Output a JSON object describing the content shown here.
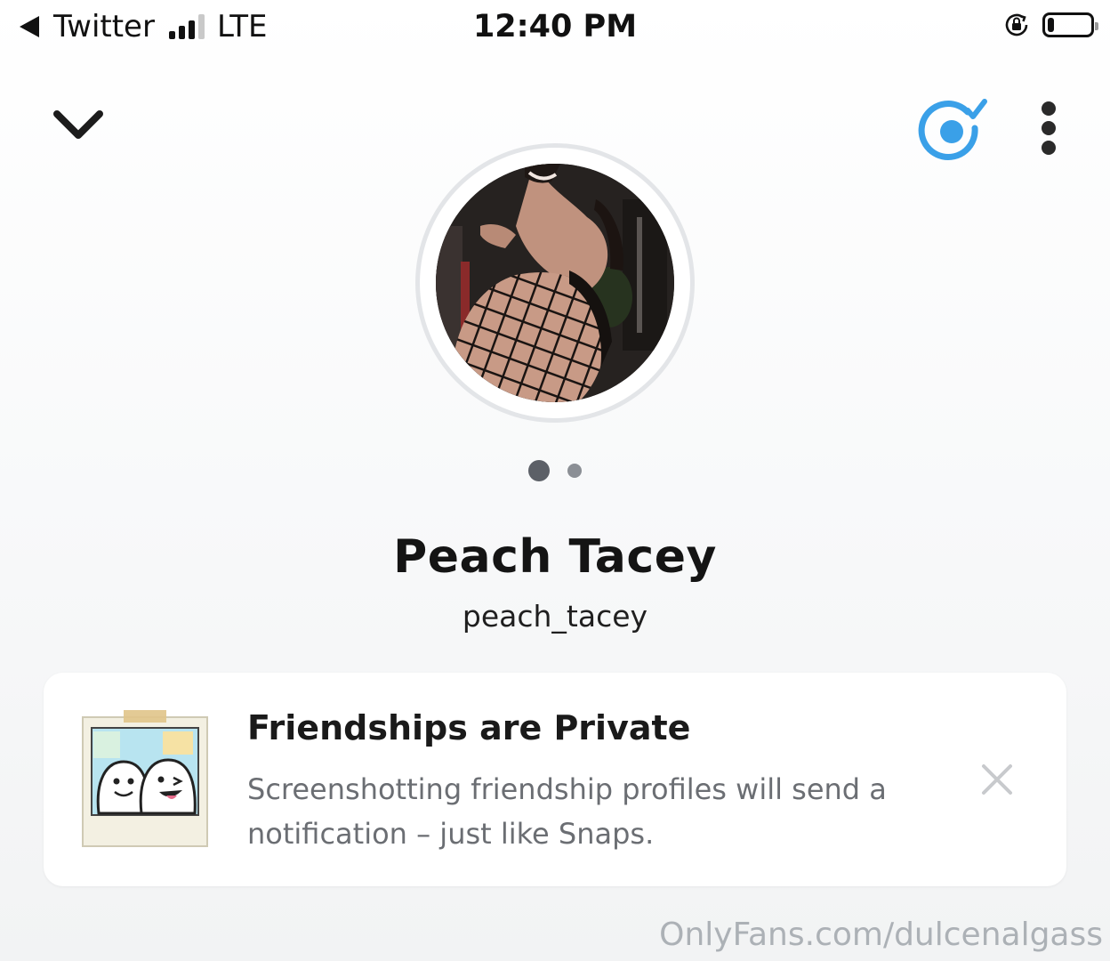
{
  "status_bar": {
    "back_app": "Twitter",
    "network": "LTE",
    "time": "12:40 PM",
    "battery_level": 0.15
  },
  "nav": {
    "collapse_icon": "chevron-down-icon",
    "story_icon": "story-ring-icon",
    "more_icon": "vertical-ellipsis-icon",
    "accent_color": "#3aa0e8"
  },
  "profile": {
    "display_name": "Peach Tacey",
    "username": "peach_tacey",
    "pager": {
      "count": 2,
      "active_index": 0
    }
  },
  "notice_card": {
    "title": "Friendships are Private",
    "body": "Screenshotting friendship profiles will send a notification – just like Snaps.",
    "close_icon": "close-icon"
  },
  "watermark": "OnlyFans.com/dulcenalgass"
}
